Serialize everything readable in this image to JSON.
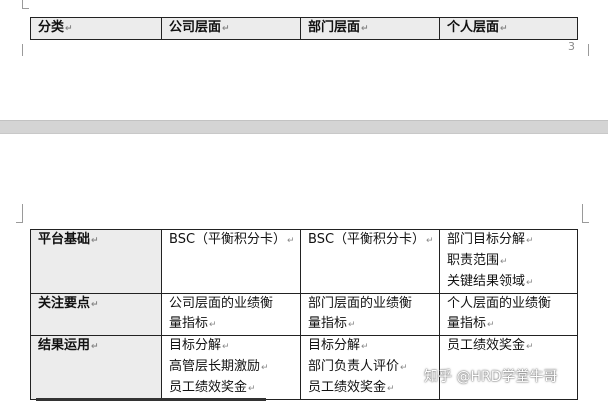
{
  "header_table": {
    "columns": [
      "分类",
      "公司层面",
      "部门层面",
      "个人层面"
    ]
  },
  "page_number": "3",
  "body_table": {
    "rows": [
      {
        "label": "平台基础",
        "company": [
          "BSC（平衡积分卡）"
        ],
        "department": [
          "BSC（平衡积分卡）"
        ],
        "personal": [
          "部门目标分解",
          "职责范围",
          "关键结果领域"
        ]
      },
      {
        "label": "关注要点",
        "company": [
          "公司层面的业绩衡",
          "量指标"
        ],
        "department": [
          "部门层面的业绩衡",
          "量指标"
        ],
        "personal": [
          "个人层面的业绩衡",
          "量指标"
        ]
      },
      {
        "label": "结果运用",
        "company": [
          "目标分解",
          "高管层长期激励",
          "员工绩效奖金"
        ],
        "department": [
          "目标分解",
          "部门负责人评价",
          "员工绩效奖金"
        ],
        "personal": [
          "员工绩效奖金"
        ]
      }
    ]
  },
  "watermark": "知乎 @HRD学堂牛哥",
  "paragraph_mark": "↵"
}
